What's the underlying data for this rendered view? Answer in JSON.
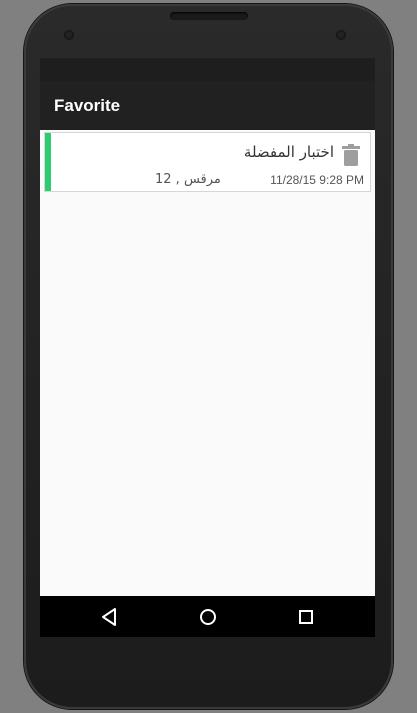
{
  "app_bar": {
    "title": "Favorite"
  },
  "favorites": [
    {
      "title": "اختبار المفضلة",
      "subtitle": "مرقس , 12",
      "date": "11/28/15 9:28 PM",
      "accent_color": "#2ecc71",
      "icon": "trash-icon"
    }
  ],
  "nav_bar": {
    "back_icon": "back-icon",
    "home_icon": "home-icon",
    "recents_icon": "recents-icon"
  }
}
